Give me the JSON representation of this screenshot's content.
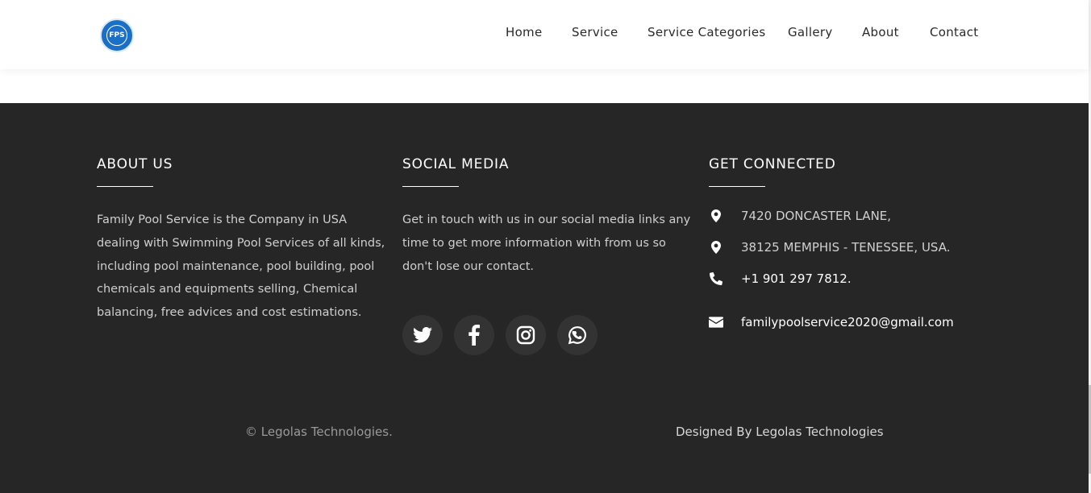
{
  "header": {
    "logo_text": "FPS",
    "nav": {
      "home": "Home",
      "service": "Service",
      "service_categories": "Service Categories",
      "gallery": "Gallery",
      "about": "About",
      "contact": "Contact"
    }
  },
  "about": {
    "heading": "ABOUT US",
    "lines": [
      "Family Pool Service is the Company in USA",
      "dealing with Swimming Pool Services of all kinds,",
      "including pool maintenance, pool building, pool",
      "chemicals and equipments selling, Chemical",
      "balancing, free advices and cost estimations."
    ]
  },
  "social": {
    "heading": "SOCIAL MEDIA",
    "lines": [
      "Get in touch with us in our social media links any",
      "time to get more information with from us so",
      "don't lose our contact."
    ],
    "icons": [
      "twitter-icon",
      "facebook-icon",
      "instagram-icon",
      "whatsapp-icon"
    ]
  },
  "connect": {
    "heading": "GET CONNECTED",
    "address_line1": "7420 DONCASTER LANE,",
    "address_line2": "38125 MEMPHIS - TENESSEE, USA.",
    "phone": "+1 901 297 7812.",
    "email": "familypoolservice2020@gmail.com"
  },
  "bottom": {
    "copyright": "© Legolas Technologies.",
    "designed_by": "Designed By Legolas Technologies"
  },
  "colors": {
    "footer_bg": "#262626",
    "social_circle": "#333333",
    "logo_blue": "#1b6fc4"
  }
}
